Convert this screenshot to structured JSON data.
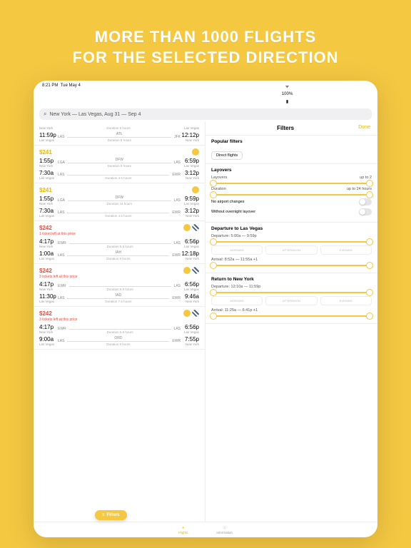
{
  "promo": {
    "line1": "MORE THAN 1000 FLIGHTS",
    "line2": "FOR THE SELECTED DIRECTION"
  },
  "status": {
    "time": "8:21 PM",
    "date": "Tue May 4",
    "wifi": "᯾",
    "battery": "100%"
  },
  "search": {
    "icon": "🔍",
    "text": "New York — Las Vegas, Aug 31 — Sep 4"
  },
  "filters": {
    "title": "Filters",
    "done": "Done",
    "popular": {
      "title": "Popular filters",
      "direct": "Direct flights"
    },
    "layovers": {
      "title": "Layovers",
      "layovers_label": "Layovers",
      "layovers_val": "up to 2",
      "duration_label": "Duration",
      "duration_val": "up to 24 hours",
      "noairport": "No airport changes",
      "overnight": "Without overnight layover"
    },
    "dep": {
      "title": "Departure to Las Vegas",
      "dep_label": "Departure:",
      "dep_val": "5:00a — 9:59p",
      "arr_label": "Arrival:",
      "arr_val": "8:52a — 11:55a +1"
    },
    "ret": {
      "title": "Return to New York",
      "dep_label": "Departure:",
      "dep_val": "12:10a — 11:59p",
      "arr_label": "Arrival:",
      "arr_val": "11:25a — 6:41p +1"
    },
    "segs": {
      "m": "MORNING",
      "a": "AFTERNOON",
      "e": "EVENING"
    }
  },
  "cards": [
    {
      "type": "partial",
      "legs": [
        {
          "l": {
            "t": "11:59p",
            "c": "Las Vegas",
            "code": "LAS"
          },
          "m": {
            "stop": "ATL",
            "dur": "Duration 8 hours"
          },
          "r": {
            "t": "12:12p",
            "c": "New York",
            "code": "JFK"
          }
        }
      ],
      "top": {
        "lc": "New York",
        "dur": "Duration 9 hours",
        "rc": "Las Vegas"
      }
    },
    {
      "price": "$241",
      "badges": [
        "y"
      ],
      "legs": [
        {
          "l": {
            "t": "1:55p",
            "c": "New York",
            "code": "LGA"
          },
          "m": {
            "stop": "DFW",
            "dur": "Duration 8 hours"
          },
          "r": {
            "t": "6:59p",
            "c": "Las Vegas",
            "code": "LAS"
          }
        },
        {
          "l": {
            "t": "7:30a",
            "c": "Las Vegas",
            "code": "LAS"
          },
          "m": {
            "stop": "",
            "dur": "Duration 4.5 hours"
          },
          "r": {
            "t": "3:12p",
            "c": "New York",
            "code": "EWR"
          }
        }
      ]
    },
    {
      "price": "$241",
      "badges": [
        "y"
      ],
      "legs": [
        {
          "l": {
            "t": "1:55p",
            "c": "New York",
            "code": "LGA"
          },
          "m": {
            "stop": "DFW",
            "dur": "Duration 11 hours"
          },
          "r": {
            "t": "9:59p",
            "c": "Las Vegas",
            "code": "LAS"
          }
        },
        {
          "l": {
            "t": "7:30a",
            "c": "Las Vegas",
            "code": "LAS"
          },
          "m": {
            "stop": "",
            "dur": "Duration 4.5 hours"
          },
          "r": {
            "t": "3:12p",
            "c": "New York",
            "code": "EWR"
          }
        }
      ]
    },
    {
      "price": "$242",
      "warn": "1 ticket left at this price",
      "badges": [
        "y",
        "b"
      ],
      "legs": [
        {
          "l": {
            "t": "4:17p",
            "c": "New York",
            "code": "EWR"
          },
          "m": {
            "stop": "",
            "dur": "Duration 5.5 hours"
          },
          "r": {
            "t": "6:56p",
            "c": "Las Vegas",
            "code": "LAS"
          }
        },
        {
          "l": {
            "t": "1:00a",
            "c": "Las Vegas",
            "code": "LAS"
          },
          "m": {
            "stop": "IAH",
            "dur": "Duration 8 hours"
          },
          "r": {
            "t": "12:18p",
            "c": "New York",
            "code": "EWR"
          }
        }
      ]
    },
    {
      "price": "$242",
      "warn": "3 tickets left at this price",
      "badges": [
        "y",
        "b"
      ],
      "legs": [
        {
          "l": {
            "t": "4:17p",
            "c": "New York",
            "code": "EWR"
          },
          "m": {
            "stop": "",
            "dur": "Duration 5.5 hours"
          },
          "r": {
            "t": "6:56p",
            "c": "Las Vegas",
            "code": "LAS"
          }
        },
        {
          "l": {
            "t": "11:30p",
            "c": "Las Vegas",
            "code": "LAS"
          },
          "m": {
            "stop": "IAD",
            "dur": "Duration 7.5 hours"
          },
          "r": {
            "t": "9:46a",
            "c": "New York",
            "code": "EWR"
          }
        }
      ]
    },
    {
      "price": "$242",
      "warn": "3 tickets left at this price",
      "badges": [
        "y",
        "b"
      ],
      "legs": [
        {
          "l": {
            "t": "4:17p",
            "c": "New York",
            "code": "EWR"
          },
          "m": {
            "stop": "",
            "dur": "Duration 5.5 hours"
          },
          "r": {
            "t": "6:56p",
            "c": "Las Vegas",
            "code": "LAS"
          }
        },
        {
          "l": {
            "t": "9:00a",
            "c": "Las Vegas",
            "code": "LAS"
          },
          "m": {
            "stop": "ORD",
            "dur": "Duration 8 hours"
          },
          "r": {
            "t": "7:55p",
            "c": "New York",
            "code": "EWR"
          }
        }
      ]
    }
  ],
  "filterBtn": "Filters",
  "tabs": {
    "flights": "Flights",
    "info": "Information"
  }
}
